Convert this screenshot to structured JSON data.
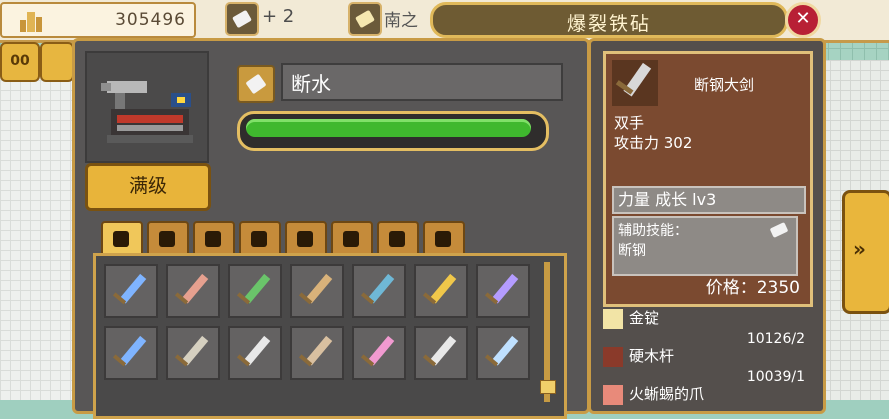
{
  "top": {
    "coins": "305496",
    "plus_label": "+ 2",
    "fragment_text": "南之",
    "title": "爆裂铁砧",
    "close_glyph": "✕",
    "pause_glyph": "00"
  },
  "weapon": {
    "name": "断水",
    "level_button": "满级",
    "bar_fill": 0.97
  },
  "tabs": [
    {
      "icon": "sword-icon",
      "active": true
    },
    {
      "icon": "spear-icon",
      "active": false
    },
    {
      "icon": "axe-icon",
      "active": false
    },
    {
      "icon": "shield-icon",
      "active": false
    },
    {
      "icon": "helmet-icon",
      "active": false
    },
    {
      "icon": "armor-icon",
      "active": false
    },
    {
      "icon": "ring-icon",
      "active": false
    },
    {
      "icon": "hat-icon",
      "active": false
    }
  ],
  "grid": {
    "rows": [
      [
        "#7fb4ff",
        "#e6a08f",
        "#6ac46a",
        "#d9b27a",
        "#6fb8d6",
        "#f0c74a",
        "#b49cff"
      ],
      [
        "#7fb4ff",
        "#d6d0c0",
        "#e8e8e8",
        "#d9c0a0",
        "#f19ad0",
        "#e8e8e8",
        "#bfe0ff"
      ]
    ]
  },
  "item_card": {
    "title": "断钢大剑",
    "type": "双手",
    "attack": "攻击力 302",
    "growth": "力量 成长 lv3",
    "assist_label": "辅助技能：",
    "assist_skill": "断钢",
    "price": "价格：2350"
  },
  "materials": [
    {
      "name": "金锭",
      "count": "",
      "color": "#f2e4a6"
    },
    {
      "name": "硬木杆",
      "count": "10126/2",
      "color": "#8a3a2a"
    },
    {
      "name": "火蜥蜴的爪",
      "count": "10039/1",
      "color": "#e88a7a"
    }
  ]
}
